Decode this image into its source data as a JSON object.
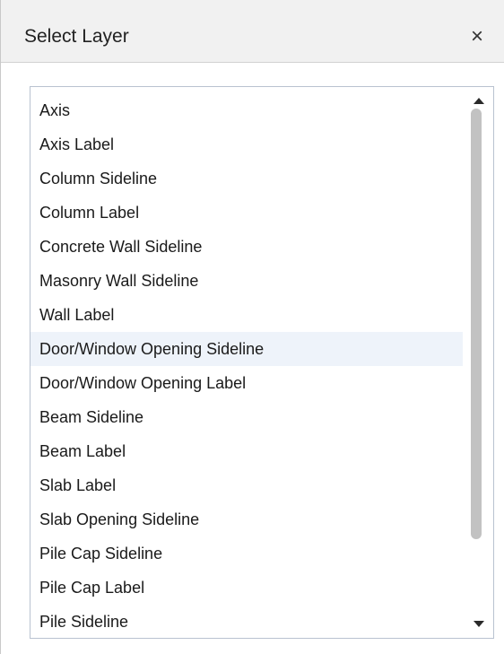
{
  "dialog": {
    "title": "Select Layer",
    "close_glyph": "×",
    "close_icon": "close-icon"
  },
  "layers": {
    "items": [
      "Axis",
      "Axis Label",
      "Column Sideline",
      "Column Label",
      "Concrete Wall Sideline",
      "Masonry Wall Sideline",
      "Wall Label",
      "Door/Window Opening Sideline",
      "Door/Window Opening Label",
      "Beam Sideline",
      "Beam Label",
      "Slab Label",
      "Slab Opening Sideline",
      "Pile Cap Sideline",
      "Pile Cap Label",
      "Pile Sideline"
    ],
    "highlighted_item": "Door/Window Opening Sideline",
    "highlight_color": "#eef3fa"
  },
  "scrollbar": {
    "up_icon": "scroll-up-arrow-icon",
    "down_icon": "scroll-down-arrow-icon",
    "position": 0
  }
}
